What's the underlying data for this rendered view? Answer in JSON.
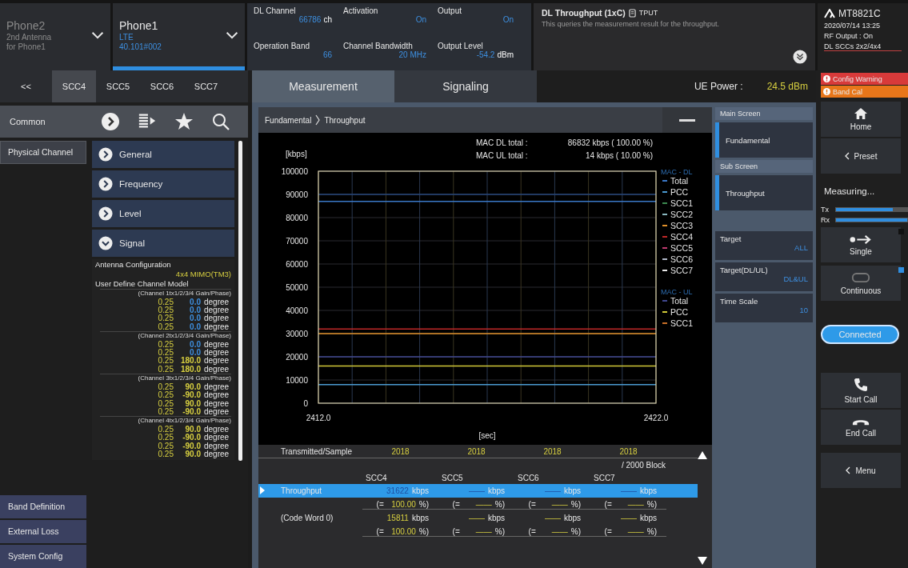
{
  "top_bar": {
    "phones": [
      {
        "name": "Phone2",
        "lines": [
          "2nd Antenna",
          "for Phone1"
        ],
        "selected": false
      },
      {
        "name": "Phone1",
        "lines": [
          "LTE",
          "40.101#002"
        ],
        "selected": true
      }
    ],
    "parameters": [
      {
        "label": "DL Channel",
        "value": "66786",
        "unit": "ch"
      },
      {
        "label": "Activation",
        "value": "On"
      },
      {
        "label": "Output",
        "value": "On"
      },
      {
        "label": "Operation Band",
        "value": "66"
      },
      {
        "label": "Channel Bandwidth",
        "value": "20 MHz"
      },
      {
        "label": "Output Level",
        "value": "-54.2",
        "unit": "dBm"
      }
    ],
    "measurement": {
      "title": "DL Throughput (1xC)",
      "tag": "TPUT",
      "description": "This queries the measurement result for the throughput."
    },
    "instrument": {
      "model": "MT8821C",
      "datetime": "2020/07/14 13:25",
      "rf_output": "RF Output : On",
      "scc_mode": "DL SCCs 2x2/4x4"
    }
  },
  "carrier_tabs": [
    {
      "label": "<<",
      "selected": false
    },
    {
      "label": "SCC4",
      "selected": true
    },
    {
      "label": "SCC5",
      "selected": false
    },
    {
      "label": "SCC6",
      "selected": false
    },
    {
      "label": "SCC7",
      "selected": false
    }
  ],
  "toolbar": {
    "label": "Common"
  },
  "nav_top": [
    {
      "label": "Physical Channel",
      "selected": true
    }
  ],
  "nav_bottom": [
    {
      "label": "Band Definition",
      "selected": false
    },
    {
      "label": "External Loss",
      "selected": false
    },
    {
      "label": "System Config",
      "selected": false
    }
  ],
  "sections": [
    {
      "label": "General",
      "expanded": false
    },
    {
      "label": "Frequency",
      "expanded": false
    },
    {
      "label": "Level",
      "expanded": false
    },
    {
      "label": "Signal",
      "expanded": true
    }
  ],
  "signal": {
    "antenna_label": "Antenna Configuration",
    "antenna_value": "4x4 MIMO(TM3)",
    "model_label": "User Define Channel Model",
    "channels": [
      {
        "header": "(Channel 1tx1/2/3/4 Gain/Phase)",
        "rows": [
          {
            "gain": "0.25",
            "phase": "0.0",
            "unit": "degree",
            "color": "#3d8fe0"
          },
          {
            "gain": "0.25",
            "phase": "0.0",
            "unit": "degree",
            "color": "#3d8fe0"
          },
          {
            "gain": "0.25",
            "phase": "0.0",
            "unit": "degree",
            "color": "#3d8fe0"
          },
          {
            "gain": "0.25",
            "phase": "0.0",
            "unit": "degree",
            "color": "#3d8fe0"
          }
        ]
      },
      {
        "header": "(Channel 2tx1/2/3/4 Gain/Phase)",
        "rows": [
          {
            "gain": "0.25",
            "phase": "0.0",
            "unit": "degree",
            "color": "#3d8fe0"
          },
          {
            "gain": "0.25",
            "phase": "0.0",
            "unit": "degree",
            "color": "#3d8fe0"
          },
          {
            "gain": "0.25",
            "phase": "180.0",
            "unit": "degree",
            "color": "#d8d040"
          },
          {
            "gain": "0.25",
            "phase": "180.0",
            "unit": "degree",
            "color": "#d8d040"
          }
        ]
      },
      {
        "header": "(Channel 3tx1/2/3/4 Gain/Phase)",
        "rows": [
          {
            "gain": "0.25",
            "phase": "90.0",
            "unit": "degree",
            "color": "#d8d040"
          },
          {
            "gain": "0.25",
            "phase": "-90.0",
            "unit": "degree",
            "color": "#d8d040"
          },
          {
            "gain": "0.25",
            "phase": "90.0",
            "unit": "degree",
            "color": "#d8d040"
          },
          {
            "gain": "0.25",
            "phase": "-90.0",
            "unit": "degree",
            "color": "#d8d040"
          }
        ]
      },
      {
        "header": "(Channel 4tx1/2/3/4 Gain/Phase)",
        "rows": [
          {
            "gain": "0.25",
            "phase": "90.0",
            "unit": "degree",
            "color": "#d8d040"
          },
          {
            "gain": "0.25",
            "phase": "-90.0",
            "unit": "degree",
            "color": "#d8d040"
          },
          {
            "gain": "0.25",
            "phase": "-90.0",
            "unit": "degree",
            "color": "#d8d040"
          },
          {
            "gain": "0.25",
            "phase": "90.0",
            "unit": "degree",
            "color": "#d8d040"
          }
        ]
      }
    ]
  },
  "main_tabs": [
    {
      "label": "Measurement",
      "selected": true
    },
    {
      "label": "Signaling",
      "selected": false
    }
  ],
  "ue_power": {
    "label": "UE Power :",
    "value": "24.5 dBm"
  },
  "alerts": [
    {
      "label": "Config Warning",
      "color": "#d83a3a"
    },
    {
      "label": "Band Cal",
      "color": "#e8761a"
    }
  ],
  "breadcrumb": [
    "Fundamental",
    "Throughput"
  ],
  "chart": {
    "totals": [
      {
        "label": "MAC DL total :",
        "value": "86832 kbps ( 100.00 %)"
      },
      {
        "label": "MAC UL total :",
        "value": "14 kbps (  10.00 %)"
      }
    ],
    "legend_groups": [
      {
        "title": "MAC - DL",
        "entries": [
          {
            "name": "Total"
          },
          {
            "name": "PCC"
          },
          {
            "name": "SCC1"
          },
          {
            "name": "SCC2"
          },
          {
            "name": "SCC3"
          },
          {
            "name": "SCC4"
          },
          {
            "name": "SCC5"
          },
          {
            "name": "SCC6"
          },
          {
            "name": "SCC7"
          }
        ]
      },
      {
        "title": "MAC - UL",
        "entries": [
          {
            "name": "Total"
          },
          {
            "name": "PCC"
          },
          {
            "name": "SCC1"
          }
        ]
      }
    ],
    "chart_data": {
      "type": "line",
      "grid": true,
      "ref_lines": [
        {
          "axis": "y",
          "value": 90000,
          "color": "#26467a"
        }
      ],
      "xlabel": "[sec]",
      "ylabel": "[kbps]",
      "x": [
        2412.0,
        2422.0
      ],
      "xlim": [
        2412,
        2422
      ],
      "ylim": [
        0,
        100000
      ],
      "xticks": [
        {
          "value": 2412,
          "label": "2412.0"
        },
        {
          "value": 2422,
          "label": "2422.0"
        }
      ],
      "yticks": [
        0,
        10000,
        20000,
        30000,
        40000,
        50000,
        60000,
        70000,
        80000,
        90000,
        100000
      ],
      "series": [
        {
          "color": "#3a78c8",
          "values": [
            87000,
            87000
          ]
        },
        {
          "color": "#4a9ad0",
          "values": [
            8000,
            8000
          ]
        },
        {
          "color": "#3c8a50",
          "values": [
            null,
            null
          ]
        },
        {
          "color": "#8ab8c0",
          "values": [
            null,
            null
          ]
        },
        {
          "color": "#e0902a",
          "values": [
            30000,
            30000
          ]
        },
        {
          "color": "#c02828",
          "values": [
            32000,
            32000
          ]
        },
        {
          "color": "#c03a70",
          "values": [
            null,
            null
          ]
        },
        {
          "color": "#b0b8c8",
          "values": [
            null,
            null
          ]
        },
        {
          "color": "#e8e8e8",
          "values": [
            null,
            null
          ]
        },
        {
          "color": "#404890",
          "values": [
            20000,
            20000
          ]
        },
        {
          "color": "#d0c838",
          "values": [
            16000,
            16000
          ]
        },
        {
          "color": "#c87028",
          "values": [
            null,
            null
          ]
        }
      ]
    }
  },
  "results": {
    "top_row": {
      "label": "Transmitted/Sample",
      "values": [
        "2018",
        "2018",
        "2018",
        "2018"
      ]
    },
    "block": "/   2000 Block",
    "columns": [
      "SCC4",
      "SCC5",
      "SCC6",
      "SCC7"
    ],
    "rows": [
      {
        "kind": "rate",
        "label": "Throughput",
        "selected": true,
        "cells": [
          {
            "value": "31622",
            "unit": "kbps"
          },
          {
            "value": "——",
            "unit": "kbps"
          },
          {
            "value": "——",
            "unit": "kbps"
          },
          {
            "value": "——",
            "unit": "kbps"
          }
        ]
      },
      {
        "kind": "percent",
        "selected": false,
        "cells": [
          {
            "prefix": "(=",
            "value": "100.00",
            "unit": "%)"
          },
          {
            "prefix": "(=",
            "value": "——",
            "unit": "%)"
          },
          {
            "prefix": "(=",
            "value": "——",
            "unit": "%)"
          },
          {
            "prefix": "(=",
            "value": "——",
            "unit": "%)"
          }
        ]
      },
      {
        "kind": "rate",
        "label": "(Code Word 0)",
        "selected": false,
        "cells": [
          {
            "value": "15811",
            "unit": "kbps"
          },
          {
            "value": "——",
            "unit": "kbps"
          },
          {
            "value": "——",
            "unit": "kbps"
          },
          {
            "value": "——",
            "unit": "kbps"
          }
        ]
      },
      {
        "kind": "percent",
        "selected": false,
        "cells": [
          {
            "prefix": "(=",
            "value": "100.00",
            "unit": "%)"
          },
          {
            "prefix": "(=",
            "value": "——",
            "unit": "%)"
          },
          {
            "prefix": "(=",
            "value": "——",
            "unit": "%)"
          },
          {
            "prefix": "(=",
            "value": "——",
            "unit": "%)"
          }
        ]
      }
    ]
  },
  "side_panel": {
    "main_label": "Main Screen",
    "main_items": [
      {
        "label": "Fundamental",
        "selected": true
      }
    ],
    "sub_label": "Sub Screen",
    "sub_items": [
      {
        "label": "Throughput",
        "selected": true
      }
    ],
    "settings": [
      {
        "label": "Target",
        "value": "ALL"
      },
      {
        "label": "Target(DL/UL)",
        "value": "DL&UL"
      },
      {
        "label": "Time Scale",
        "value": "10"
      }
    ]
  },
  "controls": {
    "home": "Home",
    "preset": "Preset",
    "status": "Measuring...",
    "meters": [
      {
        "label": "Tx",
        "level": 0.8
      },
      {
        "label": "Rx",
        "level": 1.0
      }
    ],
    "modes": [
      {
        "kind": "single",
        "label": "Single",
        "selected": false
      },
      {
        "kind": "continuous",
        "label": "Continuous",
        "selected": true
      }
    ],
    "connection": "Connected",
    "calls": [
      {
        "kind": "start",
        "label": "Start Call"
      },
      {
        "kind": "end",
        "label": "End Call"
      }
    ],
    "menu": "Menu"
  }
}
